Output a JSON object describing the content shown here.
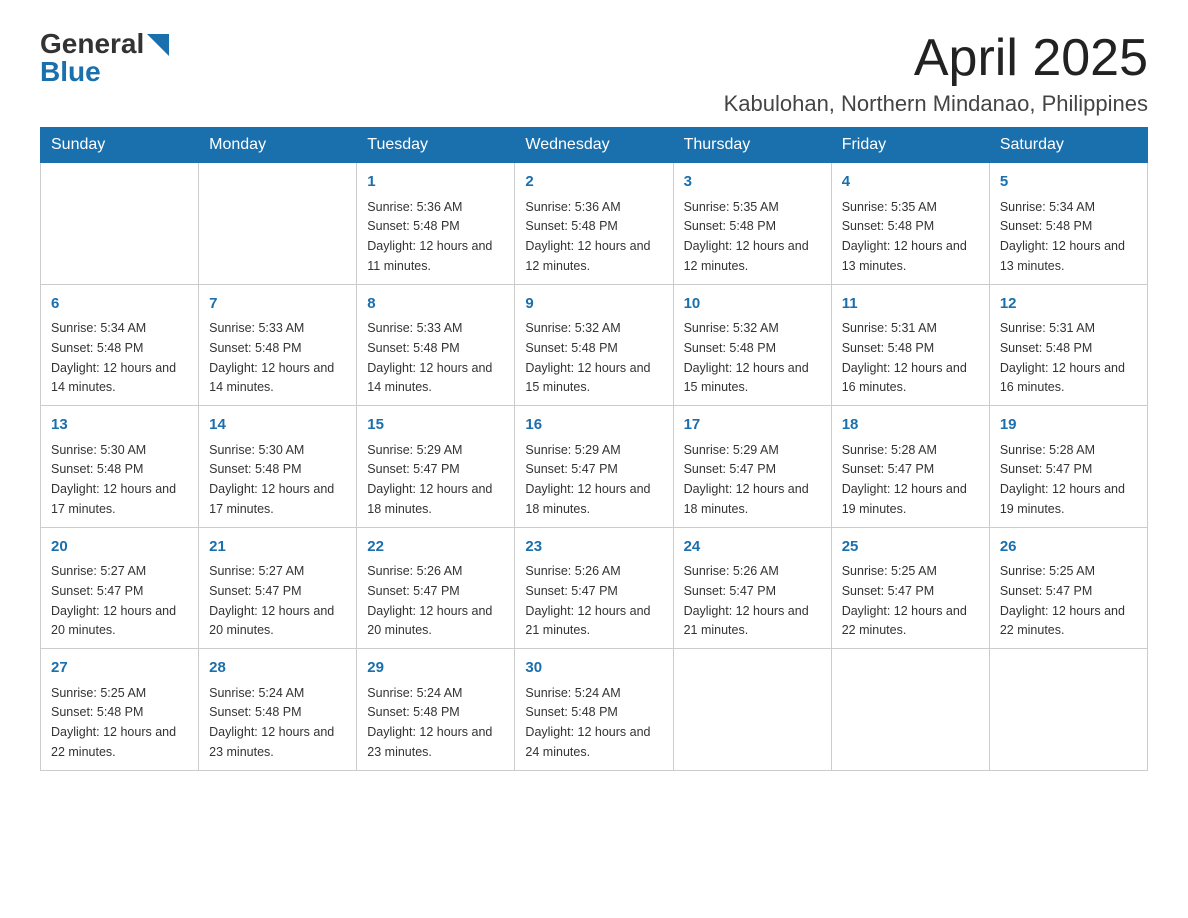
{
  "header": {
    "logo_general": "General",
    "logo_blue": "Blue",
    "title": "April 2025",
    "subtitle": "Kabulohan, Northern Mindanao, Philippines"
  },
  "calendar": {
    "days_of_week": [
      "Sunday",
      "Monday",
      "Tuesday",
      "Wednesday",
      "Thursday",
      "Friday",
      "Saturday"
    ],
    "weeks": [
      [
        {
          "day": "",
          "sunrise": "",
          "sunset": "",
          "daylight": ""
        },
        {
          "day": "",
          "sunrise": "",
          "sunset": "",
          "daylight": ""
        },
        {
          "day": "1",
          "sunrise": "Sunrise: 5:36 AM",
          "sunset": "Sunset: 5:48 PM",
          "daylight": "Daylight: 12 hours and 11 minutes."
        },
        {
          "day": "2",
          "sunrise": "Sunrise: 5:36 AM",
          "sunset": "Sunset: 5:48 PM",
          "daylight": "Daylight: 12 hours and 12 minutes."
        },
        {
          "day": "3",
          "sunrise": "Sunrise: 5:35 AM",
          "sunset": "Sunset: 5:48 PM",
          "daylight": "Daylight: 12 hours and 12 minutes."
        },
        {
          "day": "4",
          "sunrise": "Sunrise: 5:35 AM",
          "sunset": "Sunset: 5:48 PM",
          "daylight": "Daylight: 12 hours and 13 minutes."
        },
        {
          "day": "5",
          "sunrise": "Sunrise: 5:34 AM",
          "sunset": "Sunset: 5:48 PM",
          "daylight": "Daylight: 12 hours and 13 minutes."
        }
      ],
      [
        {
          "day": "6",
          "sunrise": "Sunrise: 5:34 AM",
          "sunset": "Sunset: 5:48 PM",
          "daylight": "Daylight: 12 hours and 14 minutes."
        },
        {
          "day": "7",
          "sunrise": "Sunrise: 5:33 AM",
          "sunset": "Sunset: 5:48 PM",
          "daylight": "Daylight: 12 hours and 14 minutes."
        },
        {
          "day": "8",
          "sunrise": "Sunrise: 5:33 AM",
          "sunset": "Sunset: 5:48 PM",
          "daylight": "Daylight: 12 hours and 14 minutes."
        },
        {
          "day": "9",
          "sunrise": "Sunrise: 5:32 AM",
          "sunset": "Sunset: 5:48 PM",
          "daylight": "Daylight: 12 hours and 15 minutes."
        },
        {
          "day": "10",
          "sunrise": "Sunrise: 5:32 AM",
          "sunset": "Sunset: 5:48 PM",
          "daylight": "Daylight: 12 hours and 15 minutes."
        },
        {
          "day": "11",
          "sunrise": "Sunrise: 5:31 AM",
          "sunset": "Sunset: 5:48 PM",
          "daylight": "Daylight: 12 hours and 16 minutes."
        },
        {
          "day": "12",
          "sunrise": "Sunrise: 5:31 AM",
          "sunset": "Sunset: 5:48 PM",
          "daylight": "Daylight: 12 hours and 16 minutes."
        }
      ],
      [
        {
          "day": "13",
          "sunrise": "Sunrise: 5:30 AM",
          "sunset": "Sunset: 5:48 PM",
          "daylight": "Daylight: 12 hours and 17 minutes."
        },
        {
          "day": "14",
          "sunrise": "Sunrise: 5:30 AM",
          "sunset": "Sunset: 5:48 PM",
          "daylight": "Daylight: 12 hours and 17 minutes."
        },
        {
          "day": "15",
          "sunrise": "Sunrise: 5:29 AM",
          "sunset": "Sunset: 5:47 PM",
          "daylight": "Daylight: 12 hours and 18 minutes."
        },
        {
          "day": "16",
          "sunrise": "Sunrise: 5:29 AM",
          "sunset": "Sunset: 5:47 PM",
          "daylight": "Daylight: 12 hours and 18 minutes."
        },
        {
          "day": "17",
          "sunrise": "Sunrise: 5:29 AM",
          "sunset": "Sunset: 5:47 PM",
          "daylight": "Daylight: 12 hours and 18 minutes."
        },
        {
          "day": "18",
          "sunrise": "Sunrise: 5:28 AM",
          "sunset": "Sunset: 5:47 PM",
          "daylight": "Daylight: 12 hours and 19 minutes."
        },
        {
          "day": "19",
          "sunrise": "Sunrise: 5:28 AM",
          "sunset": "Sunset: 5:47 PM",
          "daylight": "Daylight: 12 hours and 19 minutes."
        }
      ],
      [
        {
          "day": "20",
          "sunrise": "Sunrise: 5:27 AM",
          "sunset": "Sunset: 5:47 PM",
          "daylight": "Daylight: 12 hours and 20 minutes."
        },
        {
          "day": "21",
          "sunrise": "Sunrise: 5:27 AM",
          "sunset": "Sunset: 5:47 PM",
          "daylight": "Daylight: 12 hours and 20 minutes."
        },
        {
          "day": "22",
          "sunrise": "Sunrise: 5:26 AM",
          "sunset": "Sunset: 5:47 PM",
          "daylight": "Daylight: 12 hours and 20 minutes."
        },
        {
          "day": "23",
          "sunrise": "Sunrise: 5:26 AM",
          "sunset": "Sunset: 5:47 PM",
          "daylight": "Daylight: 12 hours and 21 minutes."
        },
        {
          "day": "24",
          "sunrise": "Sunrise: 5:26 AM",
          "sunset": "Sunset: 5:47 PM",
          "daylight": "Daylight: 12 hours and 21 minutes."
        },
        {
          "day": "25",
          "sunrise": "Sunrise: 5:25 AM",
          "sunset": "Sunset: 5:47 PM",
          "daylight": "Daylight: 12 hours and 22 minutes."
        },
        {
          "day": "26",
          "sunrise": "Sunrise: 5:25 AM",
          "sunset": "Sunset: 5:47 PM",
          "daylight": "Daylight: 12 hours and 22 minutes."
        }
      ],
      [
        {
          "day": "27",
          "sunrise": "Sunrise: 5:25 AM",
          "sunset": "Sunset: 5:48 PM",
          "daylight": "Daylight: 12 hours and 22 minutes."
        },
        {
          "day": "28",
          "sunrise": "Sunrise: 5:24 AM",
          "sunset": "Sunset: 5:48 PM",
          "daylight": "Daylight: 12 hours and 23 minutes."
        },
        {
          "day": "29",
          "sunrise": "Sunrise: 5:24 AM",
          "sunset": "Sunset: 5:48 PM",
          "daylight": "Daylight: 12 hours and 23 minutes."
        },
        {
          "day": "30",
          "sunrise": "Sunrise: 5:24 AM",
          "sunset": "Sunset: 5:48 PM",
          "daylight": "Daylight: 12 hours and 24 minutes."
        },
        {
          "day": "",
          "sunrise": "",
          "sunset": "",
          "daylight": ""
        },
        {
          "day": "",
          "sunrise": "",
          "sunset": "",
          "daylight": ""
        },
        {
          "day": "",
          "sunrise": "",
          "sunset": "",
          "daylight": ""
        }
      ]
    ]
  },
  "colors": {
    "header_bg": "#1a6fad",
    "header_text": "#ffffff",
    "day_number": "#1a6fad",
    "border": "#cccccc"
  }
}
